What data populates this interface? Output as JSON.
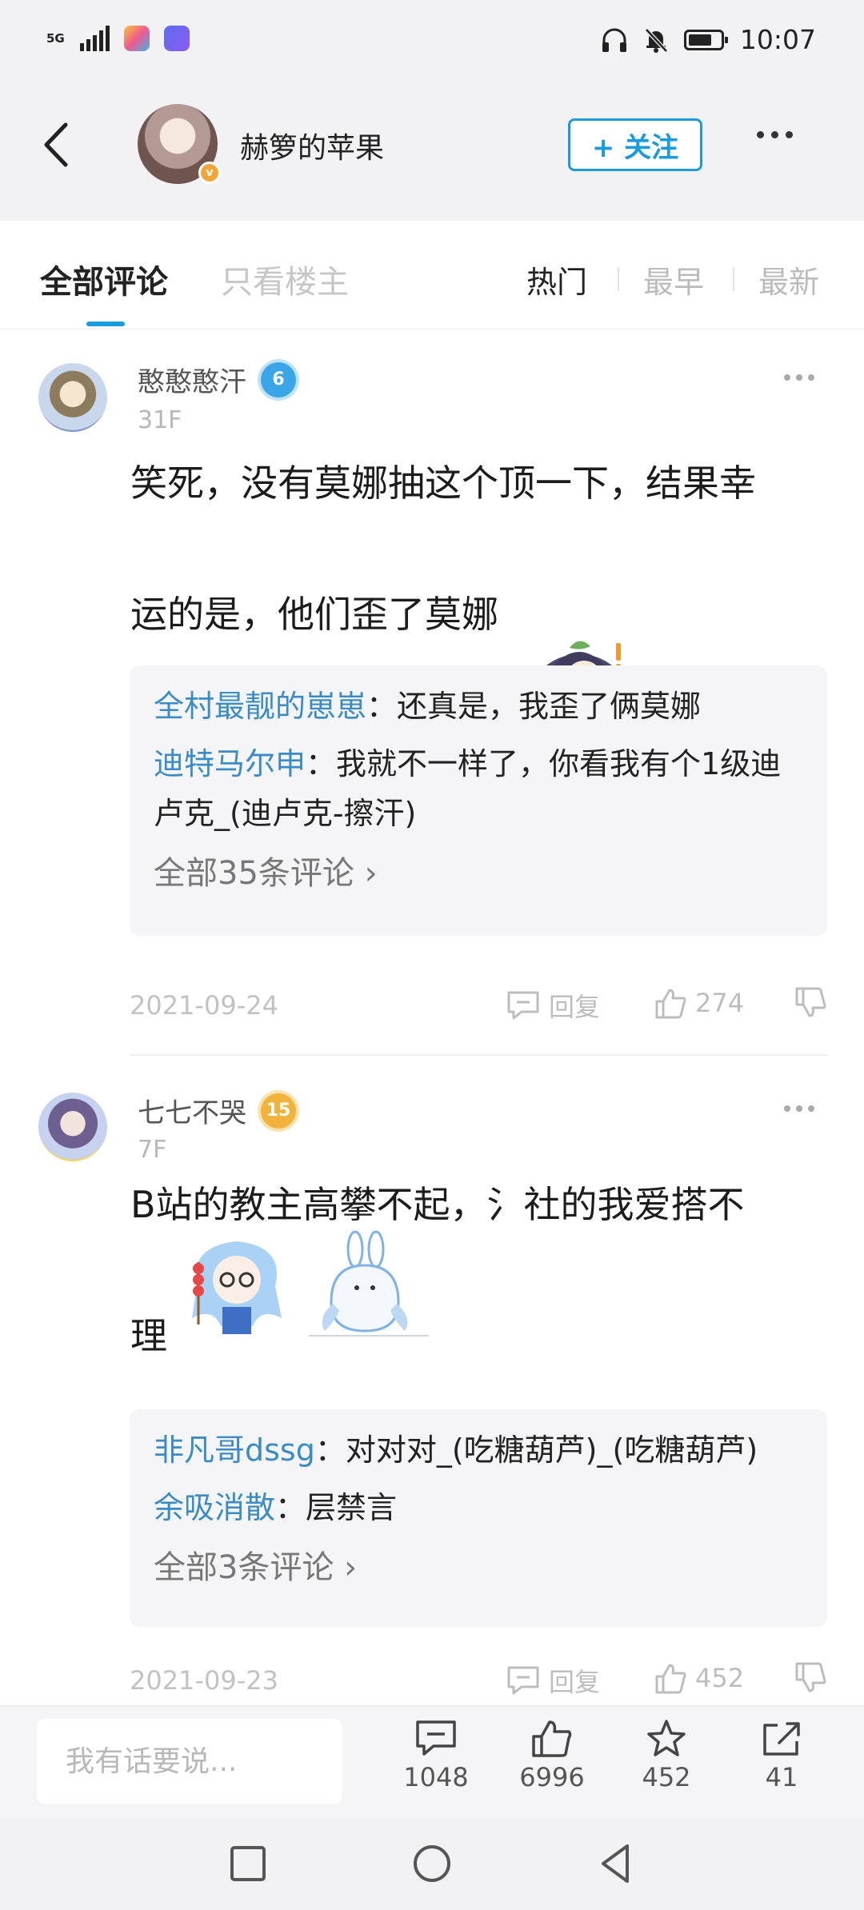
{
  "status_bar": {
    "network": "5G",
    "time": "10:07",
    "icons": [
      "signal-icon",
      "app-icon-colorful",
      "app-icon-blue",
      "headphone-icon",
      "mute-icon",
      "battery-icon"
    ]
  },
  "header": {
    "author_name": "赫箩的苹果",
    "follow_label": "+ 关注"
  },
  "tabs": {
    "all_comments": "全部评论",
    "owner_only": "只看楼主",
    "sort": [
      "热门",
      "最早",
      "最新"
    ]
  },
  "comments": [
    {
      "user": "憨憨憨汗",
      "level": "6",
      "floor": "31F",
      "text_line1": "笑死，没有莫娜抽这个顶一下，结果幸",
      "text_line2": "运的是，他们歪了莫娜",
      "replies": [
        {
          "name": "全村最靓的崽崽",
          "sep": "：",
          "text": "还真是，我歪了俩莫娜"
        },
        {
          "name": "迪特马尔申",
          "sep": "：",
          "text": "我就不一样了，你看我有个1级迪卢克_(迪卢克-擦汗)"
        }
      ],
      "view_all": "全部35条评论",
      "date": "2021-09-24",
      "reply_label": "回复",
      "likes": "274"
    },
    {
      "user": "七七不哭",
      "level": "15",
      "floor": "7F",
      "text_line1": "B站的教主高攀不起，氵社的我爱搭不",
      "text_line2": "理",
      "replies": [
        {
          "name": "非凡哥dssg",
          "sep": "：",
          "text": "对对对_(吃糖葫芦)_(吃糖葫芦)"
        },
        {
          "name": "余吸消散",
          "sep": "：",
          "text": "层禁言"
        }
      ],
      "view_all": "全部3条评论",
      "date": "2021-09-23",
      "reply_label": "回复",
      "likes": "452"
    }
  ],
  "bottom_bar": {
    "input_placeholder": "我有话要说...",
    "comments_count": "1048",
    "likes_count": "6996",
    "favorites_count": "452",
    "shares_count": "41"
  },
  "colors": {
    "accent": "#1a9be0",
    "reply_name": "#3a8cc6",
    "level6": "#3aa6e8",
    "level15": "#f2b33d"
  }
}
